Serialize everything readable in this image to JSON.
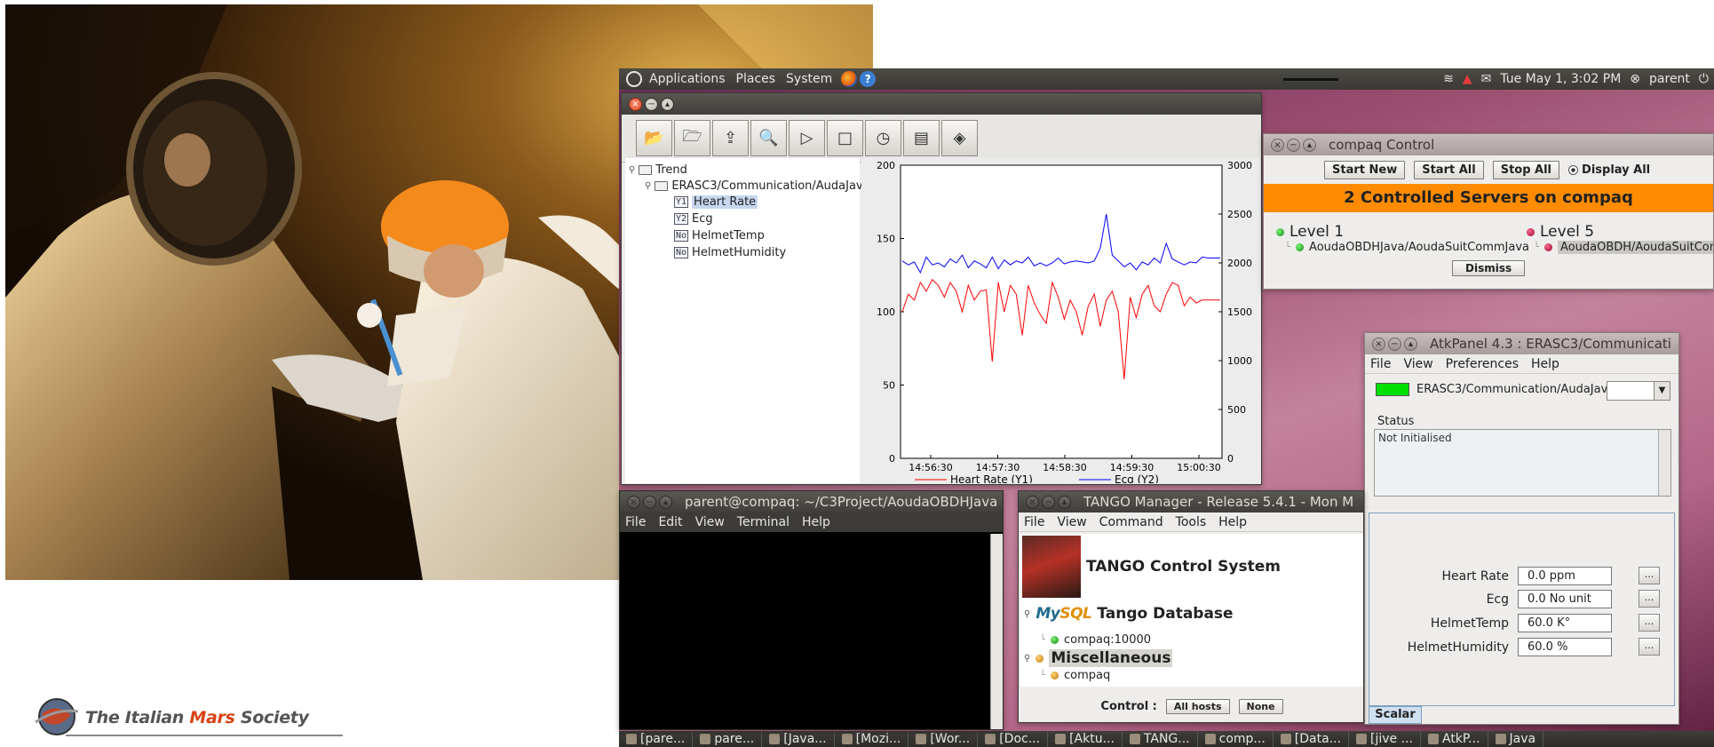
{
  "photo": {
    "description_icon": "astronaut-photo"
  },
  "logo": {
    "text_prefix": "The Italian ",
    "text_mars": "Mars",
    "text_suffix": " Society"
  },
  "top_panel": {
    "menus": [
      "Applications",
      "Places",
      "System"
    ],
    "clock": "Tue May  1,  3:02 PM",
    "user": "parent"
  },
  "trend": {
    "tree": {
      "root": "Trend",
      "device": "ERASC3/Communication/AudaJava",
      "items": [
        {
          "tag": "Y1",
          "label": "Heart Rate",
          "selected": true
        },
        {
          "tag": "Y2",
          "label": "Ecg",
          "selected": false
        },
        {
          "tag": "No",
          "label": "HelmetTemp",
          "selected": false
        },
        {
          "tag": "No",
          "label": "HelmetHumidity",
          "selected": false
        }
      ]
    },
    "toolbar_icons": [
      "open-folder-icon",
      "save-icon",
      "load-icon",
      "zoom-icon",
      "play-icon",
      "stop-icon",
      "clock-icon",
      "config-icon",
      "settings-icon"
    ]
  },
  "chart_data": {
    "type": "line",
    "title": "",
    "x_tick_labels": [
      "14:56:30",
      "14:57:30",
      "14:58:30",
      "14:59:30",
      "15:00:30"
    ],
    "y1": {
      "ticks": [
        0,
        50,
        100,
        150,
        200
      ],
      "ylim": [
        0,
        200
      ]
    },
    "y2": {
      "ticks": [
        0,
        500,
        1000,
        1500,
        2000,
        2500,
        3000
      ],
      "ylim": [
        0,
        3000
      ]
    },
    "grid": false,
    "legend_position": "bottom",
    "series": [
      {
        "name": "Heart Rate (Y1)",
        "axis": "y1",
        "color": "#ff0000",
        "values": [
          100,
          112,
          108,
          120,
          114,
          122,
          118,
          110,
          120,
          114,
          100,
          118,
          108,
          114,
          115,
          66,
          120,
          100,
          118,
          112,
          84,
          118,
          106,
          98,
          92,
          120,
          110,
          95,
          108,
          100,
          84,
          104,
          112,
          90,
          108,
          114,
          100,
          54,
          110,
          96,
          112,
          118,
          104,
          100,
          112,
          120,
          118,
          104,
          110,
          106,
          108,
          108,
          108,
          108
        ]
      },
      {
        "name": "Ecg (Y2)",
        "axis": "y2",
        "color": "#0000ff",
        "values": [
          2020,
          1980,
          2010,
          1900,
          2060,
          1980,
          2000,
          1960,
          2040,
          2000,
          2080,
          1950,
          2020,
          1990,
          1950,
          2060,
          1940,
          2030,
          1980,
          2020,
          2000,
          2060,
          1970,
          2000,
          1970,
          2000,
          2050,
          1990,
          2010,
          2020,
          2010,
          2000,
          2020,
          2150,
          2500,
          2080,
          2020,
          1960,
          2000,
          1930,
          2010,
          1980,
          2050,
          2000,
          2200,
          2040,
          2010,
          1980,
          2010,
          2000,
          2060,
          2050,
          2050,
          2050
        ]
      }
    ]
  },
  "control": {
    "title": "compaq  Control",
    "buttons": [
      "Start New",
      "Start All",
      "Stop All"
    ],
    "display_all": "Display All",
    "banner": "2 Controlled Servers on compaq",
    "level1": "Level 1",
    "level1_server": "AoudaOBDHJava/AoudaSuitCommJava",
    "level5": "Level 5",
    "level5_server": "AoudaOBDH/AoudaSuitComm",
    "dismiss": "Dismiss"
  },
  "atk": {
    "title": "AtkPanel  4.3   : ERASC3/Communicati",
    "menus": [
      "File",
      "View",
      "Preferences",
      "Help"
    ],
    "device": "ERASC3/Communication/AudaJava",
    "status_label": "Status",
    "status_text": "Not Initialised",
    "attributes": [
      {
        "label": "Heart Rate",
        "value": "0.0 ppm"
      },
      {
        "label": "Ecg",
        "value": "0.0 No unit"
      },
      {
        "label": "HelmetTemp",
        "value": "60.0 K°"
      },
      {
        "label": "HelmetHumidity",
        "value": "60.0 %"
      }
    ],
    "more_label": "...",
    "tab": "Scalar"
  },
  "terminal": {
    "title": "parent@compaq: ~/C3Project/AoudaOBDHJava",
    "menus": [
      "File",
      "Edit",
      "View",
      "Terminal",
      "Help"
    ]
  },
  "tango": {
    "title": "TANGO Manager - Release 5.4.1  - Mon M",
    "menus": [
      "File",
      "View",
      "Command",
      "Tools",
      "Help"
    ],
    "control_system": "TANGO Control System",
    "mysql_prefix": "My",
    "mysql_suffix": "SQL",
    "database": "Tango Database",
    "db_host": "compaq:10000",
    "misc": "Miscellaneous",
    "misc_host": "compaq",
    "control_label": "Control :",
    "all_hosts": "All hosts",
    "none": "None"
  },
  "taskbar": [
    "[pare...",
    "pare...",
    "[Java...",
    "[Mozi...",
    "[Wor...",
    "[Doc...",
    "[Aktu...",
    "TANG...",
    "comp...",
    "[Data...",
    "[jive ...",
    "AtkP...",
    "Java"
  ]
}
